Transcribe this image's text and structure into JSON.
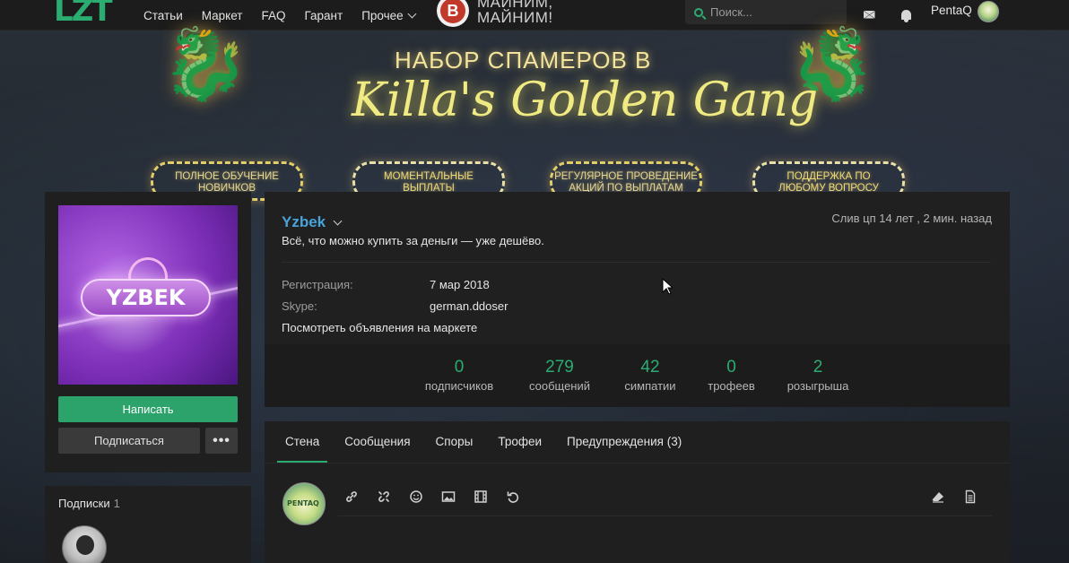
{
  "topbar": {
    "logo": "LZT",
    "nav": [
      "Статьи",
      "Маркет",
      "FAQ",
      "Гарант",
      "Прочее"
    ],
    "mine_line1": "МАЙНИМ,",
    "mine_line2": "МАЙНИМ!",
    "btc_symbol": "B",
    "search_placeholder": "Поиск...",
    "username": "PentaQ"
  },
  "banner": {
    "title_line1": "НАБОР СПАМЕРОВ В",
    "title_line2": "Killa's Golden Gang",
    "pills": [
      [
        "ПОЛНОЕ ОБУЧЕНИЕ",
        "НОВИЧКОВ"
      ],
      [
        "МОМЕНТАЛЬНЫЕ",
        "ВЫПЛАТЫ"
      ],
      [
        "РЕГУЛЯРНОЕ ПРОВЕДЕНИЕ",
        "АКЦИЙ ПО ВЫПЛАТАМ"
      ],
      [
        "ПОДДЕРЖКА ПО",
        "ЛЮБОМУ ВОПРОСУ"
      ]
    ]
  },
  "profile": {
    "avatar_text": "YZBEK",
    "write_button": "Написать",
    "follow_button": "Подписаться",
    "more_button": "•••",
    "username": "Yzbek",
    "status": "Всё, что можно купить за деньги — уже дешёво.",
    "last_seen": "Слив цп 14 лет , 2 мин. назад",
    "registration_label": "Регистрация:",
    "registration_value": "7 мар 2018",
    "skype_label": "Skype:",
    "skype_value": "german.ddoser",
    "market_link": "Посмотреть объявления на маркете",
    "stats": [
      {
        "num": "0",
        "label": "подписчиков"
      },
      {
        "num": "279",
        "label": "сообщений"
      },
      {
        "num": "42",
        "label": "симпатии"
      },
      {
        "num": "0",
        "label": "трофеев"
      },
      {
        "num": "2",
        "label": "розыгрыша"
      }
    ]
  },
  "subscriptions": {
    "title": "Подписки",
    "count": "1"
  },
  "wall": {
    "tabs": [
      "Стена",
      "Сообщения",
      "Споры",
      "Трофеи",
      "Предупреждения (3)"
    ],
    "me_avatar_text": "PENTAQ",
    "tools": [
      "link-icon",
      "unlink-icon",
      "smiley-icon",
      "image-icon",
      "video-icon",
      "undo-icon",
      "eraser-icon",
      "document-icon"
    ]
  },
  "colors": {
    "accent": "#2bad72",
    "username": "#48a3da",
    "panel": "#1f1f1f"
  }
}
